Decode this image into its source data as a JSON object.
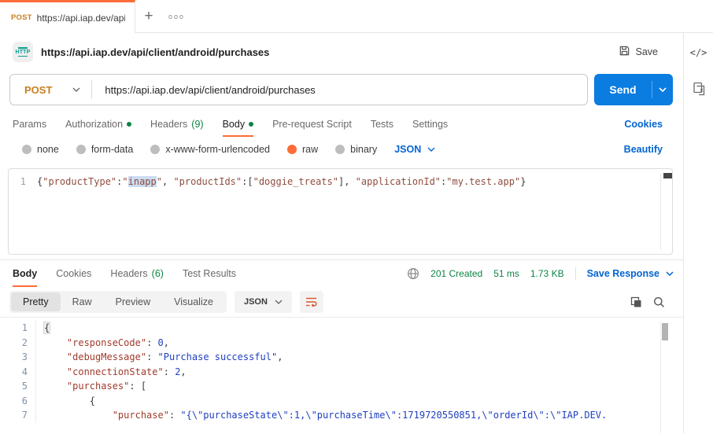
{
  "colors": {
    "accent_orange": "#ff6c37",
    "method_post": "#c77f1f",
    "link_blue": "#0265d2",
    "send_blue": "#0b7ce0",
    "success_green": "#0e8345"
  },
  "tab_bar": {
    "active_tab": {
      "method": "POST",
      "url": "https://api.iap.dev/api/cl"
    },
    "new_tab_label": "+",
    "more_label": "ooo"
  },
  "side_panel": {
    "code_icon_label": "</>"
  },
  "request": {
    "title": "https://api.iap.dev/api/client/android/purchases",
    "save_label": "Save",
    "method": "POST",
    "url": "https://api.iap.dev/api/client/android/purchases",
    "send_label": "Send",
    "tabs": {
      "params": "Params",
      "authorization": "Authorization",
      "headers": "Headers",
      "headers_count": "(9)",
      "body": "Body",
      "pre_request": "Pre-request Script",
      "tests": "Tests",
      "settings": "Settings",
      "cookies_link": "Cookies"
    },
    "body_modes": {
      "none": "none",
      "form_data": "form-data",
      "urlencoded": "x-www-form-urlencoded",
      "raw": "raw",
      "binary": "binary",
      "language": "JSON",
      "beautify_link": "Beautify"
    },
    "editor": {
      "lines": [
        {
          "num": "1",
          "tokens": [
            {
              "t": "{",
              "c": "p"
            },
            {
              "t": "\"productType\"",
              "c": "r"
            },
            {
              "t": ":",
              "c": "p"
            },
            {
              "t": "\"",
              "c": "r"
            },
            {
              "t": "inapp",
              "c": "r sel"
            },
            {
              "t": "\"",
              "c": "r"
            },
            {
              "t": ", ",
              "c": "p"
            },
            {
              "t": "\"productIds\"",
              "c": "r"
            },
            {
              "t": ":[",
              "c": "p"
            },
            {
              "t": "\"doggie_treats\"",
              "c": "r"
            },
            {
              "t": "], ",
              "c": "p"
            },
            {
              "t": "\"applicationId\"",
              "c": "r"
            },
            {
              "t": ":",
              "c": "p"
            },
            {
              "t": "\"my.test.app\"",
              "c": "r"
            },
            {
              "t": "}",
              "c": "p"
            }
          ]
        }
      ]
    }
  },
  "response": {
    "tabs": {
      "body": "Body",
      "cookies": "Cookies",
      "headers": "Headers",
      "headers_count": "(6)",
      "test_results": "Test Results"
    },
    "meta": {
      "status": "201 Created",
      "time": "51 ms",
      "size": "1.73 KB",
      "save_label": "Save Response"
    },
    "view": {
      "pretty": "Pretty",
      "raw": "Raw",
      "preview": "Preview",
      "visualize": "Visualize",
      "language": "JSON"
    },
    "editor": {
      "lines": [
        {
          "num": "1",
          "tokens": [
            {
              "t": "{",
              "c": "p hl"
            }
          ]
        },
        {
          "num": "2",
          "tokens": [
            {
              "t": "    ",
              "c": "p"
            },
            {
              "t": "\"responseCode\"",
              "c": "k"
            },
            {
              "t": ": ",
              "c": "p"
            },
            {
              "t": "0",
              "c": "n"
            },
            {
              "t": ",",
              "c": "p"
            }
          ]
        },
        {
          "num": "3",
          "tokens": [
            {
              "t": "    ",
              "c": "p"
            },
            {
              "t": "\"debugMessage\"",
              "c": "k"
            },
            {
              "t": ": ",
              "c": "p"
            },
            {
              "t": "\"Purchase successful\"",
              "c": "v"
            },
            {
              "t": ",",
              "c": "p"
            }
          ]
        },
        {
          "num": "4",
          "tokens": [
            {
              "t": "    ",
              "c": "p"
            },
            {
              "t": "\"connectionState\"",
              "c": "k"
            },
            {
              "t": ": ",
              "c": "p"
            },
            {
              "t": "2",
              "c": "n"
            },
            {
              "t": ",",
              "c": "p"
            }
          ]
        },
        {
          "num": "5",
          "tokens": [
            {
              "t": "    ",
              "c": "p"
            },
            {
              "t": "\"purchases\"",
              "c": "k"
            },
            {
              "t": ": ",
              "c": "p"
            },
            {
              "t": "[",
              "c": "p"
            }
          ]
        },
        {
          "num": "6",
          "tokens": [
            {
              "t": "        {",
              "c": "p"
            }
          ]
        },
        {
          "num": "7",
          "tokens": [
            {
              "t": "            ",
              "c": "p"
            },
            {
              "t": "\"purchase\"",
              "c": "k"
            },
            {
              "t": ": ",
              "c": "p"
            },
            {
              "t": "\"{\\\"purchaseState\\\":1,\\\"purchaseTime\\\":1719720550851,\\\"orderId\\\":\\\"IAP.DEV.",
              "c": "v"
            }
          ]
        }
      ]
    }
  }
}
